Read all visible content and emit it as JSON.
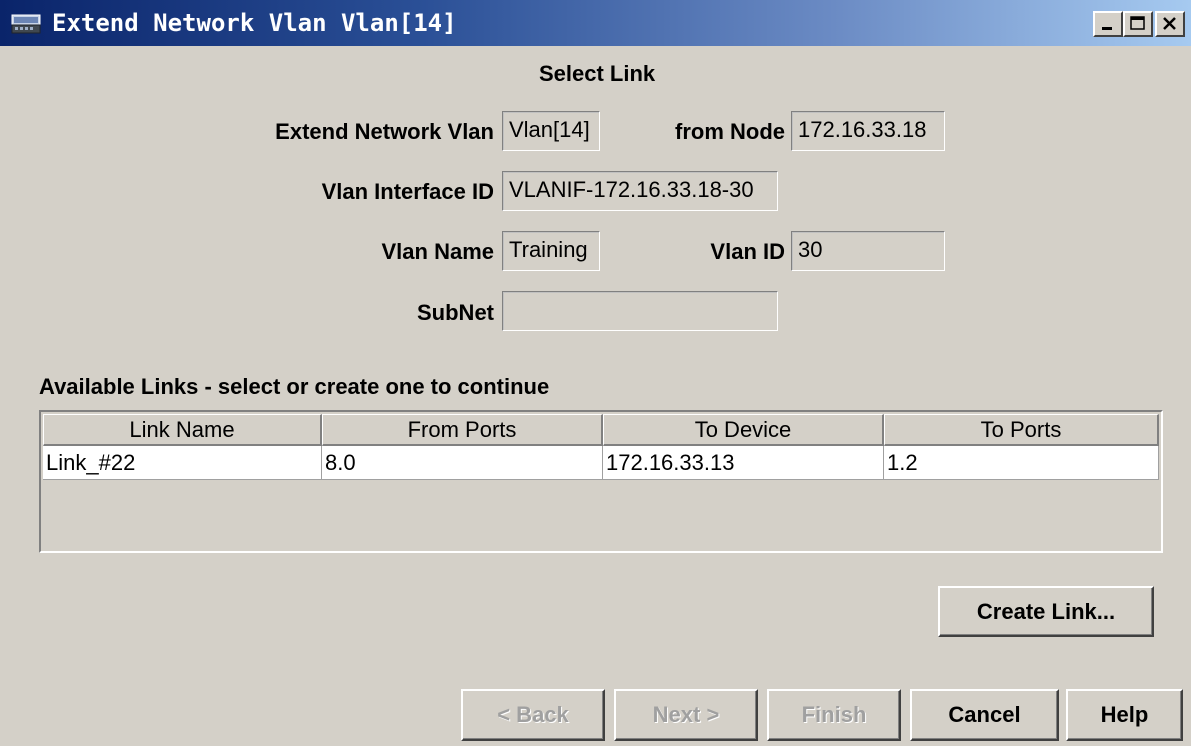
{
  "window": {
    "title": "Extend Network Vlan Vlan[14]"
  },
  "page_title": "Select Link",
  "form": {
    "extend_network_vlan": {
      "label": "Extend Network Vlan",
      "value": "Vlan[14]"
    },
    "from_node": {
      "label": "from Node",
      "value": "172.16.33.18"
    },
    "vlan_interface_id": {
      "label": "Vlan Interface ID",
      "value": "VLANIF-172.16.33.18-30"
    },
    "vlan_name": {
      "label": "Vlan Name",
      "value": "Training"
    },
    "vlan_id": {
      "label": "Vlan ID",
      "value": "30"
    },
    "subnet": {
      "label": "SubNet",
      "value": ""
    }
  },
  "links": {
    "heading": "Available Links - select or create one to continue",
    "columns": [
      "Link Name",
      "From Ports",
      "To Device",
      "To Ports"
    ],
    "rows": [
      [
        "Link_#22",
        "8.0",
        "172.16.33.13",
        "1.2"
      ]
    ]
  },
  "buttons": {
    "create_link": "Create Link...",
    "back": "< Back",
    "next": "Next >",
    "finish": "Finish",
    "cancel": "Cancel",
    "help": "Help"
  },
  "colors": {
    "titlebar_start": "#0a246a",
    "titlebar_end": "#a6caf0",
    "window_bg": "#d4d0c8"
  },
  "icons": {
    "app": "network-device-icon",
    "minimize": "minimize-icon",
    "maximize": "maximize-icon",
    "close": "close-icon"
  }
}
